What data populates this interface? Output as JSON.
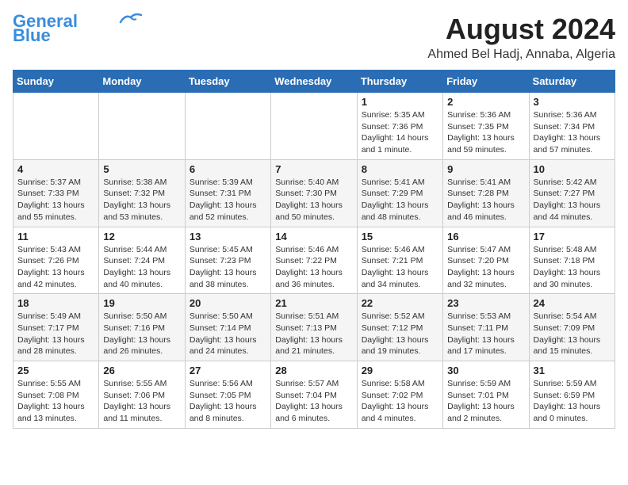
{
  "header": {
    "logo_line1": "General",
    "logo_line2": "Blue",
    "month_year": "August 2024",
    "location": "Ahmed Bel Hadj, Annaba, Algeria"
  },
  "weekdays": [
    "Sunday",
    "Monday",
    "Tuesday",
    "Wednesday",
    "Thursday",
    "Friday",
    "Saturday"
  ],
  "weeks": [
    [
      {
        "day": "",
        "info": ""
      },
      {
        "day": "",
        "info": ""
      },
      {
        "day": "",
        "info": ""
      },
      {
        "day": "",
        "info": ""
      },
      {
        "day": "1",
        "info": "Sunrise: 5:35 AM\nSunset: 7:36 PM\nDaylight: 14 hours\nand 1 minute."
      },
      {
        "day": "2",
        "info": "Sunrise: 5:36 AM\nSunset: 7:35 PM\nDaylight: 13 hours\nand 59 minutes."
      },
      {
        "day": "3",
        "info": "Sunrise: 5:36 AM\nSunset: 7:34 PM\nDaylight: 13 hours\nand 57 minutes."
      }
    ],
    [
      {
        "day": "4",
        "info": "Sunrise: 5:37 AM\nSunset: 7:33 PM\nDaylight: 13 hours\nand 55 minutes."
      },
      {
        "day": "5",
        "info": "Sunrise: 5:38 AM\nSunset: 7:32 PM\nDaylight: 13 hours\nand 53 minutes."
      },
      {
        "day": "6",
        "info": "Sunrise: 5:39 AM\nSunset: 7:31 PM\nDaylight: 13 hours\nand 52 minutes."
      },
      {
        "day": "7",
        "info": "Sunrise: 5:40 AM\nSunset: 7:30 PM\nDaylight: 13 hours\nand 50 minutes."
      },
      {
        "day": "8",
        "info": "Sunrise: 5:41 AM\nSunset: 7:29 PM\nDaylight: 13 hours\nand 48 minutes."
      },
      {
        "day": "9",
        "info": "Sunrise: 5:41 AM\nSunset: 7:28 PM\nDaylight: 13 hours\nand 46 minutes."
      },
      {
        "day": "10",
        "info": "Sunrise: 5:42 AM\nSunset: 7:27 PM\nDaylight: 13 hours\nand 44 minutes."
      }
    ],
    [
      {
        "day": "11",
        "info": "Sunrise: 5:43 AM\nSunset: 7:26 PM\nDaylight: 13 hours\nand 42 minutes."
      },
      {
        "day": "12",
        "info": "Sunrise: 5:44 AM\nSunset: 7:24 PM\nDaylight: 13 hours\nand 40 minutes."
      },
      {
        "day": "13",
        "info": "Sunrise: 5:45 AM\nSunset: 7:23 PM\nDaylight: 13 hours\nand 38 minutes."
      },
      {
        "day": "14",
        "info": "Sunrise: 5:46 AM\nSunset: 7:22 PM\nDaylight: 13 hours\nand 36 minutes."
      },
      {
        "day": "15",
        "info": "Sunrise: 5:46 AM\nSunset: 7:21 PM\nDaylight: 13 hours\nand 34 minutes."
      },
      {
        "day": "16",
        "info": "Sunrise: 5:47 AM\nSunset: 7:20 PM\nDaylight: 13 hours\nand 32 minutes."
      },
      {
        "day": "17",
        "info": "Sunrise: 5:48 AM\nSunset: 7:18 PM\nDaylight: 13 hours\nand 30 minutes."
      }
    ],
    [
      {
        "day": "18",
        "info": "Sunrise: 5:49 AM\nSunset: 7:17 PM\nDaylight: 13 hours\nand 28 minutes."
      },
      {
        "day": "19",
        "info": "Sunrise: 5:50 AM\nSunset: 7:16 PM\nDaylight: 13 hours\nand 26 minutes."
      },
      {
        "day": "20",
        "info": "Sunrise: 5:50 AM\nSunset: 7:14 PM\nDaylight: 13 hours\nand 24 minutes."
      },
      {
        "day": "21",
        "info": "Sunrise: 5:51 AM\nSunset: 7:13 PM\nDaylight: 13 hours\nand 21 minutes."
      },
      {
        "day": "22",
        "info": "Sunrise: 5:52 AM\nSunset: 7:12 PM\nDaylight: 13 hours\nand 19 minutes."
      },
      {
        "day": "23",
        "info": "Sunrise: 5:53 AM\nSunset: 7:11 PM\nDaylight: 13 hours\nand 17 minutes."
      },
      {
        "day": "24",
        "info": "Sunrise: 5:54 AM\nSunset: 7:09 PM\nDaylight: 13 hours\nand 15 minutes."
      }
    ],
    [
      {
        "day": "25",
        "info": "Sunrise: 5:55 AM\nSunset: 7:08 PM\nDaylight: 13 hours\nand 13 minutes."
      },
      {
        "day": "26",
        "info": "Sunrise: 5:55 AM\nSunset: 7:06 PM\nDaylight: 13 hours\nand 11 minutes."
      },
      {
        "day": "27",
        "info": "Sunrise: 5:56 AM\nSunset: 7:05 PM\nDaylight: 13 hours\nand 8 minutes."
      },
      {
        "day": "28",
        "info": "Sunrise: 5:57 AM\nSunset: 7:04 PM\nDaylight: 13 hours\nand 6 minutes."
      },
      {
        "day": "29",
        "info": "Sunrise: 5:58 AM\nSunset: 7:02 PM\nDaylight: 13 hours\nand 4 minutes."
      },
      {
        "day": "30",
        "info": "Sunrise: 5:59 AM\nSunset: 7:01 PM\nDaylight: 13 hours\nand 2 minutes."
      },
      {
        "day": "31",
        "info": "Sunrise: 5:59 AM\nSunset: 6:59 PM\nDaylight: 13 hours\nand 0 minutes."
      }
    ]
  ]
}
